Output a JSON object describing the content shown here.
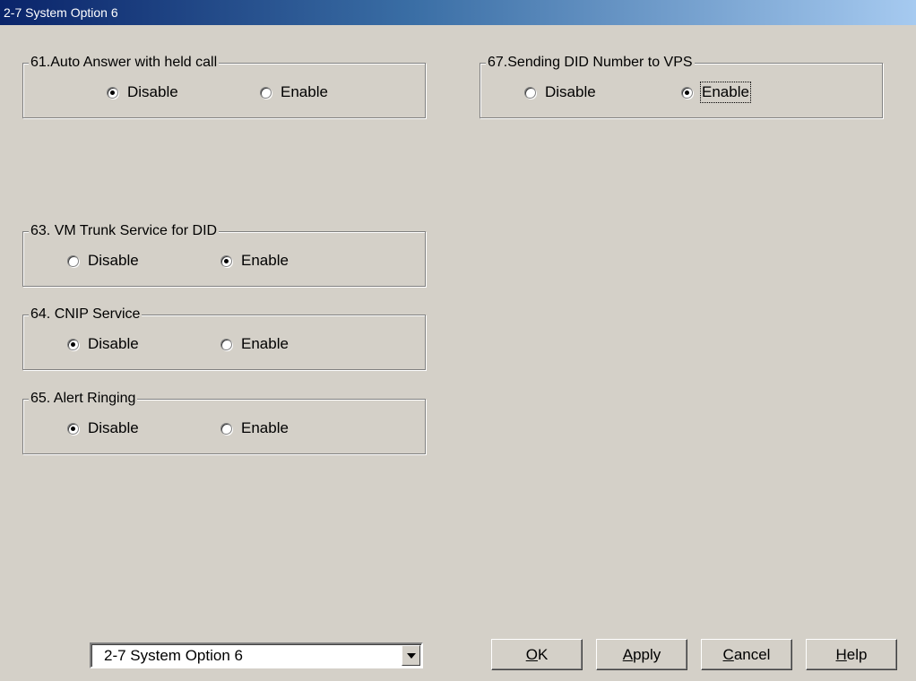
{
  "window": {
    "title": "2-7 System Option 6"
  },
  "groups": {
    "g61": {
      "legend": "61.Auto Answer with held call",
      "option1": "Disable",
      "option2": "Enable",
      "selected": "Disable"
    },
    "g67": {
      "legend": "67.Sending DID Number to VPS",
      "option1": "Disable",
      "option2": "Enable",
      "selected": "Enable"
    },
    "g63": {
      "legend": "63. VM Trunk Service for DID",
      "option1": "Disable",
      "option2": "Enable",
      "selected": "Enable"
    },
    "g64": {
      "legend": "64. CNIP Service",
      "option1": "Disable",
      "option2": "Enable",
      "selected": "Disable"
    },
    "g65": {
      "legend": "65. Alert Ringing",
      "option1": "Disable",
      "option2": "Enable",
      "selected": "Disable"
    }
  },
  "footer": {
    "page_select_value": "2-7 System Option 6",
    "ok": {
      "accel": "O",
      "rest": "K"
    },
    "apply": {
      "accel": "A",
      "rest": "pply"
    },
    "cancel": {
      "accel": "C",
      "rest": "ancel"
    },
    "help": {
      "accel": "H",
      "rest": "elp"
    }
  }
}
